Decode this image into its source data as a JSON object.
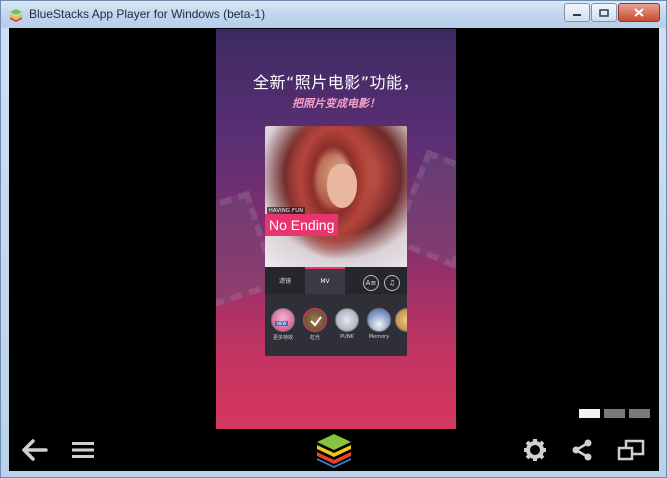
{
  "window": {
    "title": "BlueStacks App Player for Windows (beta-1)",
    "controls": {
      "minimize_icon": "minimize-icon",
      "maximize_icon": "maximize-icon",
      "close_icon": "close-icon"
    }
  },
  "phone": {
    "headline": "全新“照片电影”功能，",
    "subline": "把照片变成电影！",
    "card": {
      "photo_tag": "HAVING FUN",
      "photo_title": "No Ending",
      "tabs": [
        {
          "label": "滤镜"
        },
        {
          "label": "MV"
        }
      ],
      "text_button_label": "A≡",
      "music_button_label": "♫",
      "effects": [
        {
          "label": "更多特效",
          "badge": "NEW"
        },
        {
          "label": "虹光"
        },
        {
          "label": "PUNK"
        },
        {
          "label": "Memory"
        }
      ]
    }
  },
  "page_indicators": {
    "count": 3,
    "active_index": 0
  },
  "bottom_bar": {
    "back_icon": "back-arrow-icon",
    "menu_icon": "menu-icon",
    "home_icon": "bluestacks-logo-icon",
    "settings_icon": "gear-icon",
    "share_icon": "share-icon",
    "window_icon": "multi-window-icon"
  },
  "colors": {
    "accent_pink": "#e8356f",
    "titlebar": "#c2d6ee",
    "background": "#000000"
  }
}
